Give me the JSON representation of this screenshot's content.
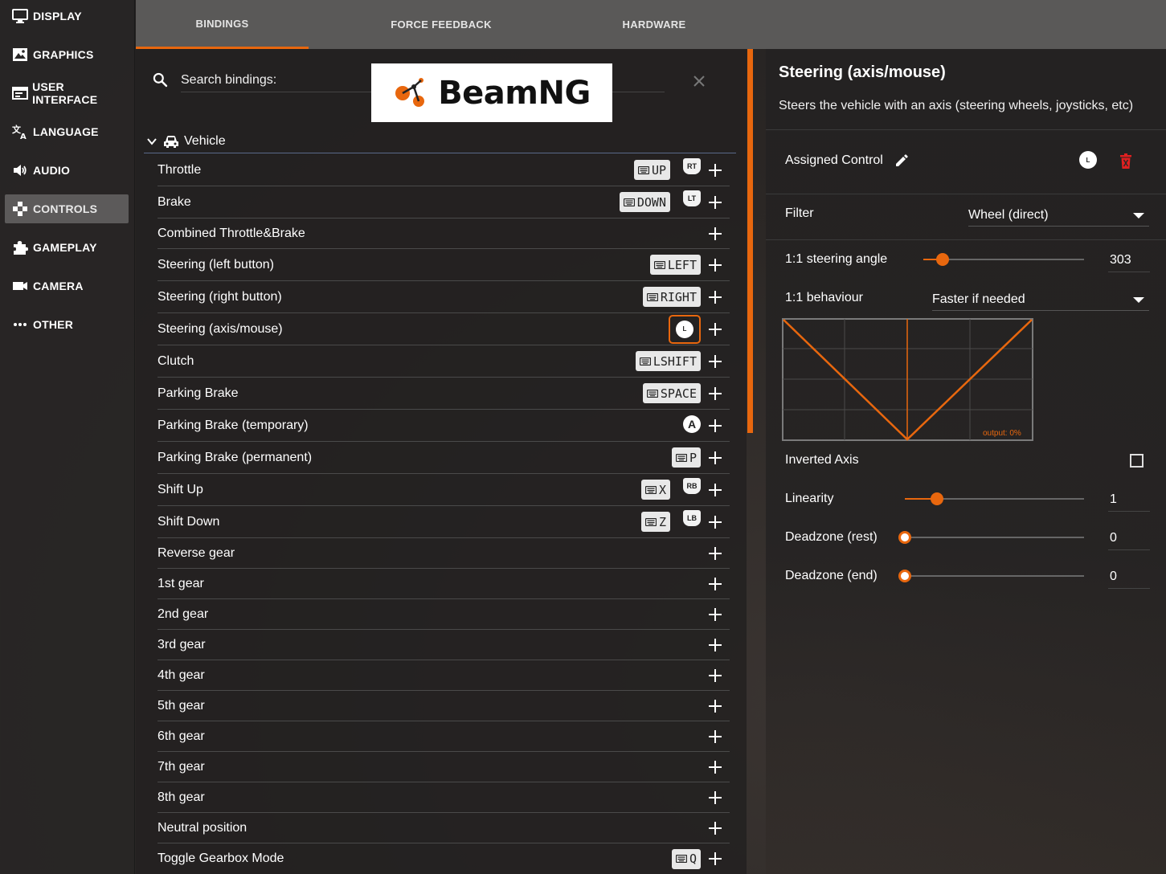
{
  "sidebar": {
    "items": [
      {
        "label": "DISPLAY",
        "icon": "monitor-icon",
        "active": false
      },
      {
        "label": "GRAPHICS",
        "icon": "image-icon",
        "active": false
      },
      {
        "label": "USER INTERFACE",
        "icon": "window-icon",
        "active": false
      },
      {
        "label": "LANGUAGE",
        "icon": "translate-icon",
        "active": false
      },
      {
        "label": "AUDIO",
        "icon": "speaker-icon",
        "active": false
      },
      {
        "label": "CONTROLS",
        "icon": "gamepad-icon",
        "active": true
      },
      {
        "label": "GAMEPLAY",
        "icon": "puzzle-icon",
        "active": false
      },
      {
        "label": "CAMERA",
        "icon": "camera-icon",
        "active": false
      },
      {
        "label": "OTHER",
        "icon": "more-icon",
        "active": false
      }
    ]
  },
  "tabs": [
    {
      "label": "BINDINGS",
      "active": true
    },
    {
      "label": "FORCE FEEDBACK",
      "active": false
    },
    {
      "label": "HARDWARE",
      "active": false
    }
  ],
  "search": {
    "placeholder": "Search bindings:",
    "value": ""
  },
  "logo": {
    "text": "BeamNG"
  },
  "category": {
    "label": "Vehicle",
    "icon": "car-icon"
  },
  "bindings": [
    {
      "label": "Throttle",
      "keys": [
        "UP"
      ],
      "pad": "RT"
    },
    {
      "label": "Brake",
      "keys": [
        "DOWN"
      ],
      "pad": "LT"
    },
    {
      "label": "Combined Throttle&Brake",
      "keys": [],
      "pad": ""
    },
    {
      "label": "Steering (left button)",
      "keys": [
        "LEFT"
      ],
      "pad": ""
    },
    {
      "label": "Steering (right button)",
      "keys": [
        "RIGHT"
      ],
      "pad": ""
    },
    {
      "label": "Steering (axis/mouse)",
      "keys": [],
      "pad": "",
      "axis": "L",
      "selected": true
    },
    {
      "label": "Clutch",
      "keys": [
        "LSHIFT"
      ],
      "pad": ""
    },
    {
      "label": "Parking Brake",
      "keys": [
        "SPACE"
      ],
      "pad": ""
    },
    {
      "label": "Parking Brake (temporary)",
      "keys": [],
      "pad": "",
      "button": "A"
    },
    {
      "label": "Parking Brake (permanent)",
      "keys": [
        "P"
      ],
      "pad": ""
    },
    {
      "label": "Shift Up",
      "keys": [
        "X"
      ],
      "pad": "RB"
    },
    {
      "label": "Shift Down",
      "keys": [
        "Z"
      ],
      "pad": "LB"
    },
    {
      "label": "Reverse gear",
      "keys": [],
      "pad": ""
    },
    {
      "label": "1st gear",
      "keys": [],
      "pad": ""
    },
    {
      "label": "2nd gear",
      "keys": [],
      "pad": ""
    },
    {
      "label": "3rd gear",
      "keys": [],
      "pad": ""
    },
    {
      "label": "4th gear",
      "keys": [],
      "pad": ""
    },
    {
      "label": "5th gear",
      "keys": [],
      "pad": ""
    },
    {
      "label": "6th gear",
      "keys": [],
      "pad": ""
    },
    {
      "label": "7th gear",
      "keys": [],
      "pad": ""
    },
    {
      "label": "8th gear",
      "keys": [],
      "pad": ""
    },
    {
      "label": "Neutral position",
      "keys": [],
      "pad": ""
    },
    {
      "label": "Toggle Gearbox Mode",
      "keys": [
        "Q"
      ],
      "pad": ""
    }
  ],
  "details": {
    "title": "Steering (axis/mouse)",
    "description": "Steers the vehicle with an axis (steering wheels, joysticks, etc)",
    "assigned_label": "Assigned Control",
    "assigned_axis": "L",
    "filter_label": "Filter",
    "filter_value": "Wheel (direct)",
    "steering_angle_label": "1:1 steering angle",
    "steering_angle_value": "303",
    "steering_angle_fraction": 0.12,
    "behaviour_label": "1:1 behaviour",
    "behaviour_value": "Faster if needed",
    "output_label": "output: 0%",
    "inverted_label": "Inverted Axis",
    "inverted_checked": false,
    "linearity_label": "Linearity",
    "linearity_value": "1",
    "linearity_fraction": 0.18,
    "deadzone_rest_label": "Deadzone (rest)",
    "deadzone_rest_value": "0",
    "deadzone_end_label": "Deadzone (end)",
    "deadzone_end_value": "0",
    "accent_color": "#e8670e",
    "delete_color": "#e02020"
  }
}
